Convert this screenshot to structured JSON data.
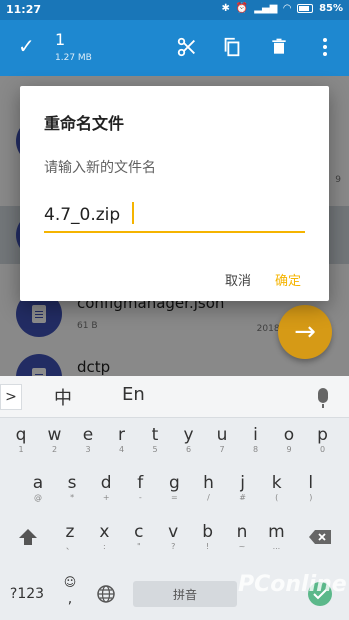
{
  "status_bar": {
    "time": "11:27",
    "battery": "85%"
  },
  "app_bar": {
    "selected_count": "1",
    "selected_size": "1.27 MB"
  },
  "list": {
    "items": [
      {
        "name": "configmanager.json",
        "meta": "61 B",
        "date": "2018年8月2",
        "num": ""
      },
      {
        "name": "dctp",
        "meta": "",
        "date": "",
        "num": ""
      }
    ],
    "partial_row_num": "9"
  },
  "dialog": {
    "title": "重命名文件",
    "prompt": "请输入新的文件名",
    "value": "4.7_0.zip",
    "cancel": "取消",
    "confirm": "确定"
  },
  "keyboard": {
    "expand": ">",
    "mode_zh": "中",
    "mode_en": "En",
    "row1": [
      {
        "k": "q",
        "s": "1"
      },
      {
        "k": "w",
        "s": "2"
      },
      {
        "k": "e",
        "s": "3"
      },
      {
        "k": "r",
        "s": "4"
      },
      {
        "k": "t",
        "s": "5"
      },
      {
        "k": "y",
        "s": "6"
      },
      {
        "k": "u",
        "s": "7"
      },
      {
        "k": "i",
        "s": "8"
      },
      {
        "k": "o",
        "s": "9"
      },
      {
        "k": "p",
        "s": "0"
      }
    ],
    "row2": [
      {
        "k": "a",
        "s": "@"
      },
      {
        "k": "s",
        "s": "*"
      },
      {
        "k": "d",
        "s": "+"
      },
      {
        "k": "f",
        "s": "-"
      },
      {
        "k": "g",
        "s": "="
      },
      {
        "k": "h",
        "s": "/"
      },
      {
        "k": "j",
        "s": "#"
      },
      {
        "k": "k",
        "s": "("
      },
      {
        "k": "l",
        "s": ")"
      }
    ],
    "row3": [
      {
        "k": "z",
        "s": "、"
      },
      {
        "k": "x",
        "s": ":"
      },
      {
        "k": "c",
        "s": "\""
      },
      {
        "k": "v",
        "s": "?"
      },
      {
        "k": "b",
        "s": "!"
      },
      {
        "k": "n",
        "s": "~"
      },
      {
        "k": "m",
        "s": "..."
      }
    ],
    "sym": "?123",
    "emoji": "☺",
    "comma": ",",
    "space_label": "拼音",
    "watermark": "PConline"
  }
}
